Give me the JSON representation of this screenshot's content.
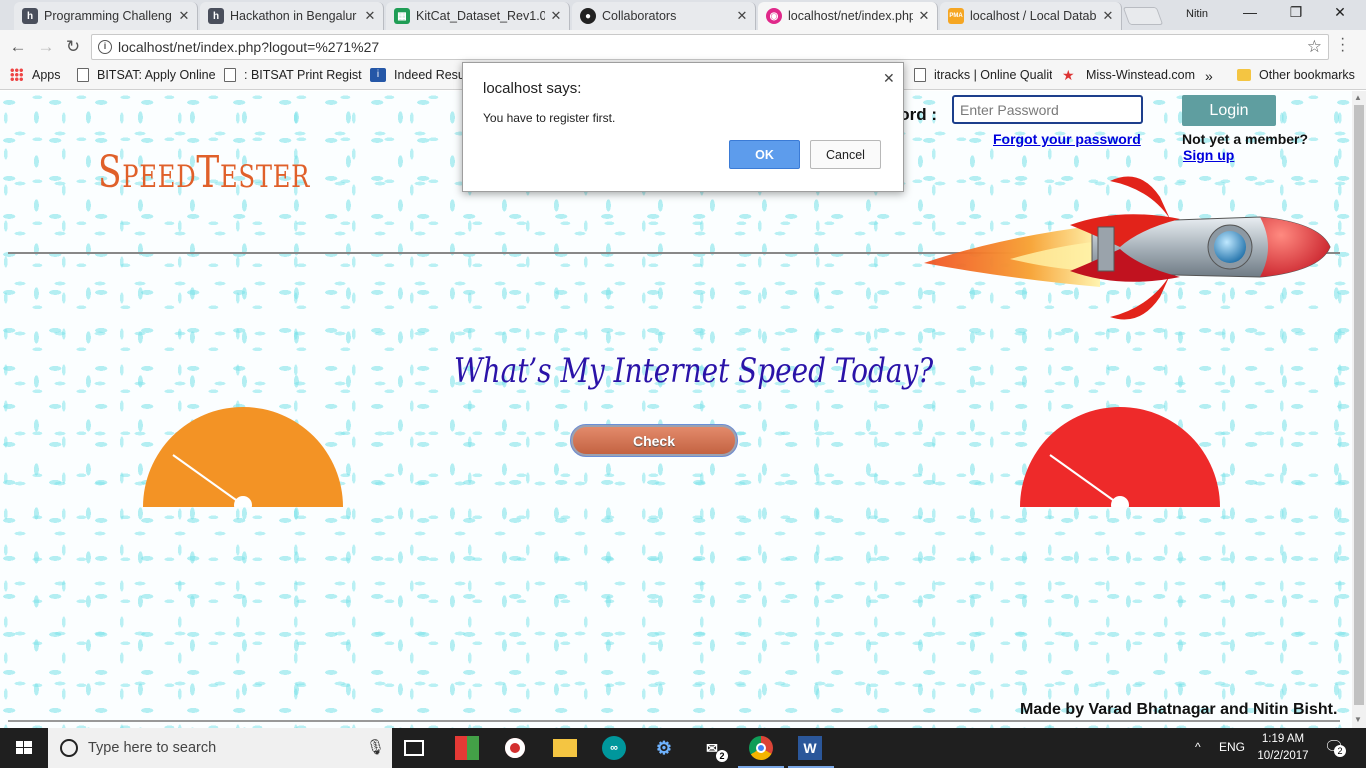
{
  "browser": {
    "tabs": [
      {
        "title": "Programming Challeng",
        "favicon": "h",
        "favicon_color": "#4a4f5c"
      },
      {
        "title": "Hackathon in Bengalur",
        "favicon": "h",
        "favicon_color": "#4a4f5c"
      },
      {
        "title": "KitCat_Dataset_Rev1.0.c",
        "favicon": "▦",
        "favicon_color": "#1f9d55"
      },
      {
        "title": "Collaborators",
        "favicon": "●",
        "favicon_color": "#222222"
      },
      {
        "title": "localhost/net/index.php",
        "favicon": "◉",
        "favicon_color": "#e0288a"
      },
      {
        "title": "localhost / Local Datab",
        "favicon": "PMA",
        "favicon_color": "#f5a623"
      }
    ],
    "user_name": "Nitin",
    "window_controls": {
      "minimize": "—",
      "restore": "❐",
      "close": "✕"
    },
    "url": "localhost/net/index.php?logout=%271%27",
    "bookmarks": [
      {
        "label": "Apps",
        "icon": "apps-icon"
      },
      {
        "label": "BITSAT: Apply Online",
        "icon": "document-icon"
      },
      {
        "label": ": BITSAT Print Registr",
        "icon": "document-icon"
      },
      {
        "label": "Indeed Resum",
        "icon": "indeed-icon"
      },
      {
        "label": "itracks | Online Qualit",
        "icon": "document-icon"
      },
      {
        "label": "Miss-Winstead.com",
        "icon": "star-icon"
      },
      {
        "label": "Other bookmarks",
        "icon": "folder-icon"
      }
    ],
    "bookmarks_overflow": "»"
  },
  "page": {
    "logo": "SpeedTester",
    "password_label": "word :",
    "password_placeholder": "Enter Password",
    "login_button": "Login",
    "forgot_link": "Forgot your password",
    "not_member_text": "Not yet a member?",
    "signup_link": "Sign up",
    "headline": "What’s My Internet Speed Today?",
    "check_button": "Check",
    "credit": "Made by Varad Bhatnagar and Nitin Bisht.",
    "gauge_colors": {
      "left": "#f39325",
      "right": "#ee2a2a"
    }
  },
  "dialog": {
    "title": "localhost says:",
    "message": "You have to register first.",
    "ok_label": "OK",
    "cancel_label": "Cancel"
  },
  "taskbar": {
    "search_placeholder": "Type here to search",
    "language": "ENG",
    "time": "1:19 AM",
    "date": "10/2/2017",
    "notification_count": "2",
    "mail_badge": "2"
  }
}
